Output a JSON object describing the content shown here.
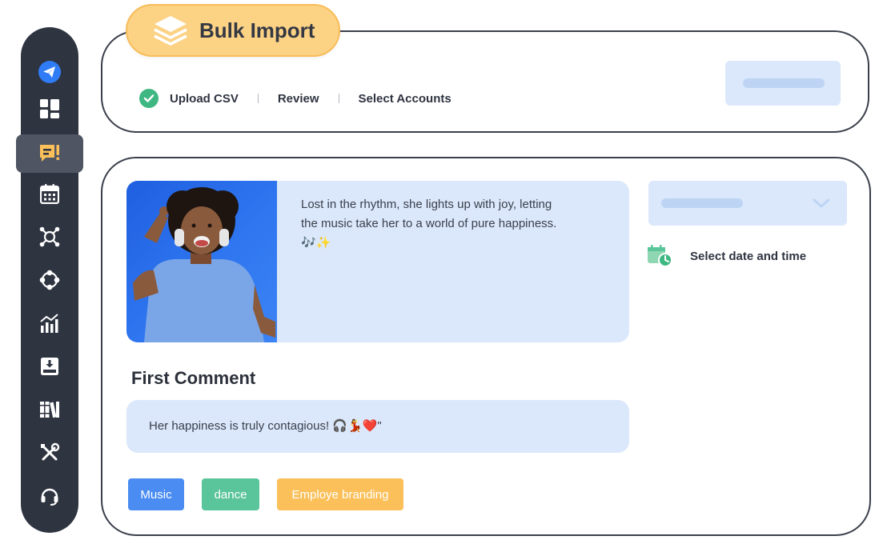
{
  "sidebar": {
    "items": [
      {
        "icon": "paper-plane-icon",
        "active": false
      },
      {
        "icon": "dashboard-grid-icon",
        "active": false
      },
      {
        "icon": "post-composer-icon",
        "active": true
      },
      {
        "icon": "calendar-icon",
        "active": false
      },
      {
        "icon": "network-hub-icon",
        "active": false
      },
      {
        "icon": "workflow-cycle-icon",
        "active": false
      },
      {
        "icon": "analytics-chart-icon",
        "active": false
      },
      {
        "icon": "inbox-download-icon",
        "active": false
      },
      {
        "icon": "library-books-icon",
        "active": false
      },
      {
        "icon": "tools-icon",
        "active": false
      },
      {
        "icon": "headset-support-icon",
        "active": false
      }
    ]
  },
  "header": {
    "title": "Bulk Import",
    "title_icon": "layers-icon",
    "steps": [
      {
        "label": "Upload CSV",
        "completed": true
      },
      {
        "label": "Review",
        "completed": false
      },
      {
        "label": "Select Accounts",
        "completed": false
      }
    ]
  },
  "post": {
    "caption": "Lost in the rhythm, she lights up with joy, letting the music take her to a world of pure happiness. 🎶✨",
    "image": "woman-dancing-with-headphones-photo"
  },
  "first_comment": {
    "title": "First Comment",
    "text": "Her happiness is truly contagious! 🎧💃❤️\""
  },
  "tags": [
    "Music",
    "dance",
    "Employe branding"
  ],
  "schedule": {
    "label": "Select date and time",
    "icon": "calendar-clock-icon"
  },
  "colors": {
    "sidebar_bg": "#2f3441",
    "accent_yellow": "#fcd285",
    "card_blue": "#dbe8fb",
    "success_green": "#3fb783",
    "tag_blue": "#4a8cf2",
    "tag_green": "#5ac49a",
    "tag_orange": "#fbc05a"
  }
}
